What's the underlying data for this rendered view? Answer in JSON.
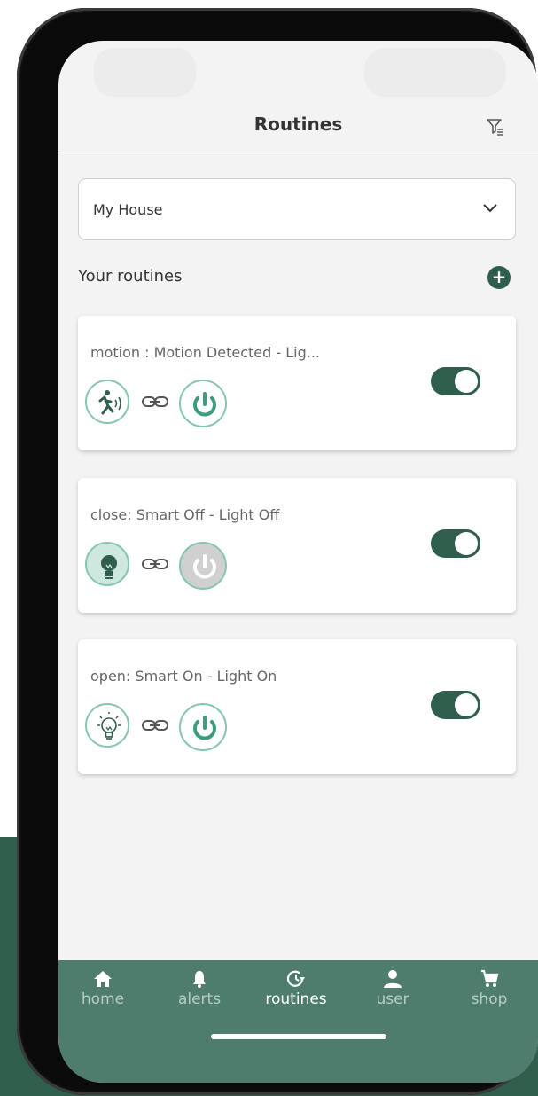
{
  "header": {
    "title": "Routines",
    "filter_icon": "filter-icon"
  },
  "location_select": {
    "value": "My House"
  },
  "routines_section": {
    "title": "Your routines",
    "add_icon": "plus-icon"
  },
  "routines": [
    {
      "title": "motion : Motion Detected - Lig...",
      "trigger_icon": "motion-icon",
      "action_icon": "power-icon",
      "action_state": "on",
      "enabled": true
    },
    {
      "title": "close: Smart Off - Light Off",
      "trigger_icon": "bulb-off-icon",
      "action_icon": "power-icon",
      "action_state": "off",
      "enabled": true
    },
    {
      "title": "open: Smart On - Light On",
      "trigger_icon": "bulb-on-icon",
      "action_icon": "power-icon",
      "action_state": "on",
      "enabled": true
    }
  ],
  "bottom_nav": [
    {
      "label": "home",
      "icon": "home-icon",
      "active": false
    },
    {
      "label": "alerts",
      "icon": "bell-icon",
      "active": false
    },
    {
      "label": "routines",
      "icon": "clock-icon",
      "active": true
    },
    {
      "label": "user",
      "icon": "user-icon",
      "active": false
    },
    {
      "label": "shop",
      "icon": "cart-icon",
      "active": false
    }
  ],
  "colors": {
    "accent": "#2f5f4c",
    "icon_border": "#86c6b0",
    "nav_bg": "#4f7d6d"
  }
}
